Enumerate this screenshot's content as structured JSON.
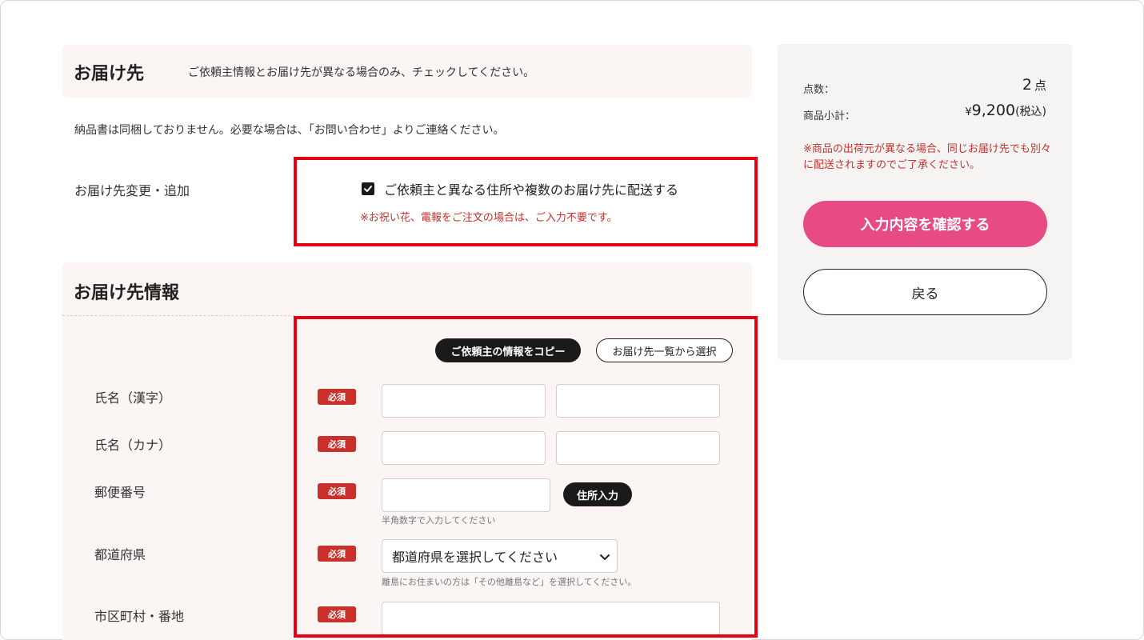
{
  "delivery": {
    "title": "お届け先",
    "header_note": "ご依頼主情報とお届け先が異なる場合のみ、チェックしてください。",
    "notice": "納品書は同梱しておりません。必要な場合は、「お問い合わせ」よりご連絡ください。",
    "change_label": "お届け先変更・追加",
    "checkbox_label": "ご依頼主と異なる住所や複数のお届け先に配送する",
    "checkbox_checked": true,
    "checkbox_note": "※お祝い花、電報をご注文の場合は、ご入力不要です。"
  },
  "info": {
    "title": "お届け先情報",
    "copy_button": "ご依頼主の情報をコピー",
    "select_list_button": "お届け先一覧から選択",
    "required_badge": "必須",
    "name_kanji_label": "氏名（漢字）",
    "name_kana_label": "氏名（カナ）",
    "postal_label": "郵便番号",
    "postal_hint": "半角数字で入力してください",
    "address_lookup_button": "住所入力",
    "prefecture_label": "都道府県",
    "prefecture_selected": "都道府県を選択してください",
    "prefecture_hint": "離島にお住まいの方は「その他離島など」を選択してください。",
    "city_label": "市区町村・番地"
  },
  "summary": {
    "count_label": "点数：",
    "count_value": "2",
    "count_unit": "点",
    "subtotal_label": "商品小計：",
    "subtotal_currency": "¥",
    "subtotal_value": "9,200",
    "subtotal_tax": "(税込)",
    "note": "※商品の出荷元が異なる場合、同じお届け先でも別々に配送されますのでご了承ください。",
    "confirm_button": "入力内容を確認する",
    "back_button": "戻る"
  },
  "colors": {
    "highlight_border": "#e60012",
    "confirm_button": "#e84a85",
    "required_badge": "#c9302c",
    "panel_bg": "#fbf6f3"
  }
}
